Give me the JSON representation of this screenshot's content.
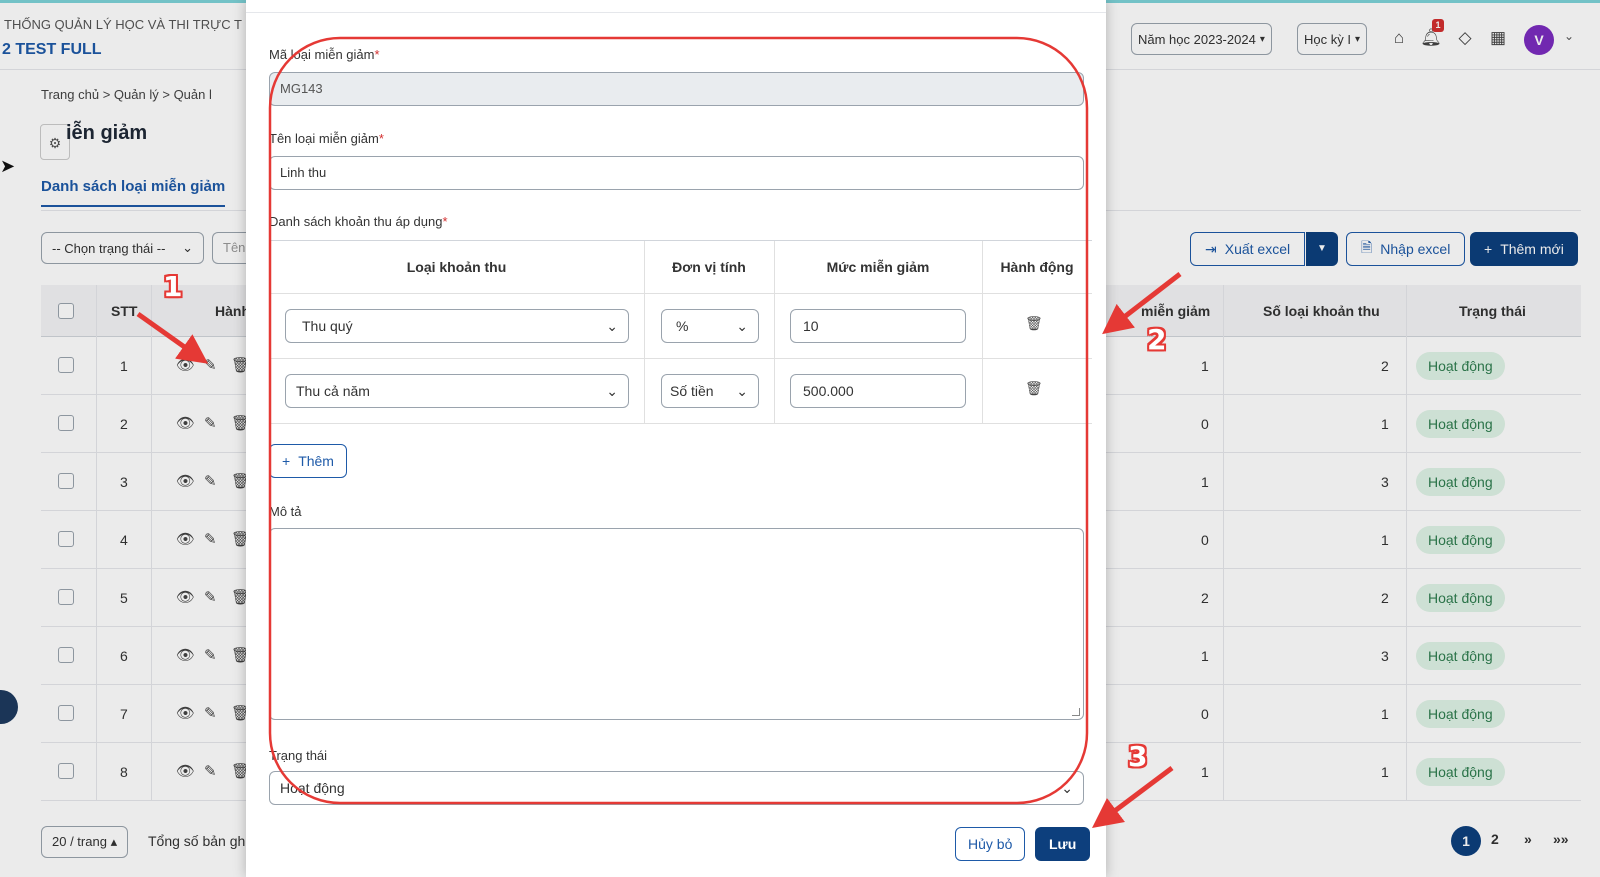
{
  "header": {
    "system_name": "THỐNG QUẢN LÝ HỌC VÀ THI TRỰC T",
    "school_name": "2 TEST FULL",
    "school_year": "Năm học 2023-2024",
    "semester": "Học kỳ I",
    "notification_count": "1",
    "avatar_letter": "V"
  },
  "breadcrumb": [
    "Trang chủ",
    "Quản lý",
    "Quản l"
  ],
  "page_title": "iễn giảm",
  "list_tab": "Danh sách loại miễn giảm",
  "filters": {
    "status_placeholder": "-- Chọn trạng thái --",
    "name_placeholder": "Tên"
  },
  "toolbar": {
    "export_label": "Xuất excel",
    "import_label": "Nhập excel",
    "add_label": "Thêm mới"
  },
  "table": {
    "headers": {
      "stt": "STT",
      "actions": "Hành",
      "discount": "miễn giảm",
      "fee_count": "Số loại khoản thu",
      "status": "Trạng thái"
    },
    "rows": [
      {
        "stt": "1",
        "discount": "1",
        "fee_count": "2",
        "status": "Hoạt động"
      },
      {
        "stt": "2",
        "discount": "0",
        "fee_count": "1",
        "status": "Hoạt động"
      },
      {
        "stt": "3",
        "discount": "1",
        "fee_count": "3",
        "status": "Hoạt động"
      },
      {
        "stt": "4",
        "discount": "0",
        "fee_count": "1",
        "status": "Hoạt động"
      },
      {
        "stt": "5",
        "discount": "2",
        "fee_count": "2",
        "status": "Hoạt động"
      },
      {
        "stt": "6",
        "discount": "1",
        "fee_count": "3",
        "status": "Hoạt động"
      },
      {
        "stt": "7",
        "discount": "0",
        "fee_count": "1",
        "status": "Hoạt động"
      },
      {
        "stt": "8",
        "discount": "1",
        "fee_count": "1",
        "status": "Hoạt động"
      }
    ]
  },
  "footer": {
    "per_page": "20 / trang",
    "total_label": "Tổng số bản gh",
    "page_current": "1",
    "page_next": "2",
    "next_icon": "»",
    "last_icon": "»»"
  },
  "modal": {
    "code_label": "Mã loại miễn giảm",
    "code_value": "MG143",
    "name_label": "Tên loại miễn giảm",
    "name_value": "Linh thu",
    "fees_label": "Danh sách khoản thu áp dụng",
    "fee_table": {
      "headers": {
        "fee_type": "Loại khoản thu",
        "unit": "Đơn vị tính",
        "amount": "Mức miễn giảm",
        "action": "Hành động"
      },
      "rows": [
        {
          "fee_type": "Thu quý",
          "unit": "%",
          "amount": "10"
        },
        {
          "fee_type": "Thu cả năm",
          "unit": "Số tiền",
          "amount": "500.000"
        }
      ]
    },
    "add_label": "Thêm",
    "description_label": "Mô tả",
    "description_value": "",
    "status_label": "Trạng thái",
    "status_value": "Hoạt động",
    "cancel_label": "Hủy bỏ",
    "save_label": "Lưu"
  },
  "annotations": {
    "step1": "1",
    "step2": "2",
    "step3": "3",
    "color": "#e53935"
  }
}
